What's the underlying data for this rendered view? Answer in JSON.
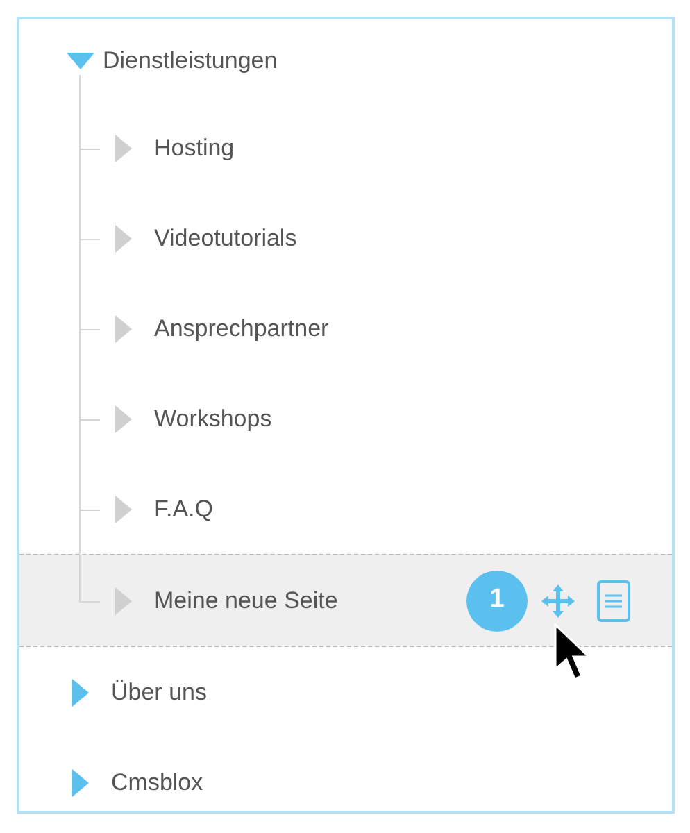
{
  "tree": [
    {
      "label": "Dienstleistungen",
      "expanded": true,
      "selected": false,
      "children": [
        {
          "label": "Hosting",
          "expanded": false,
          "selected": false
        },
        {
          "label": "Videotutorials",
          "expanded": false,
          "selected": false
        },
        {
          "label": "Ansprechpartner",
          "expanded": false,
          "selected": false
        },
        {
          "label": "Workshops",
          "expanded": false,
          "selected": false
        },
        {
          "label": "F.A.Q",
          "expanded": false,
          "selected": false
        },
        {
          "label": "Meine neue Seite",
          "expanded": false,
          "selected": true,
          "badge": "1"
        }
      ]
    },
    {
      "label": "Über uns",
      "expanded": false,
      "selected": false
    },
    {
      "label": "Cmsblox",
      "expanded": false,
      "selected": false
    }
  ]
}
